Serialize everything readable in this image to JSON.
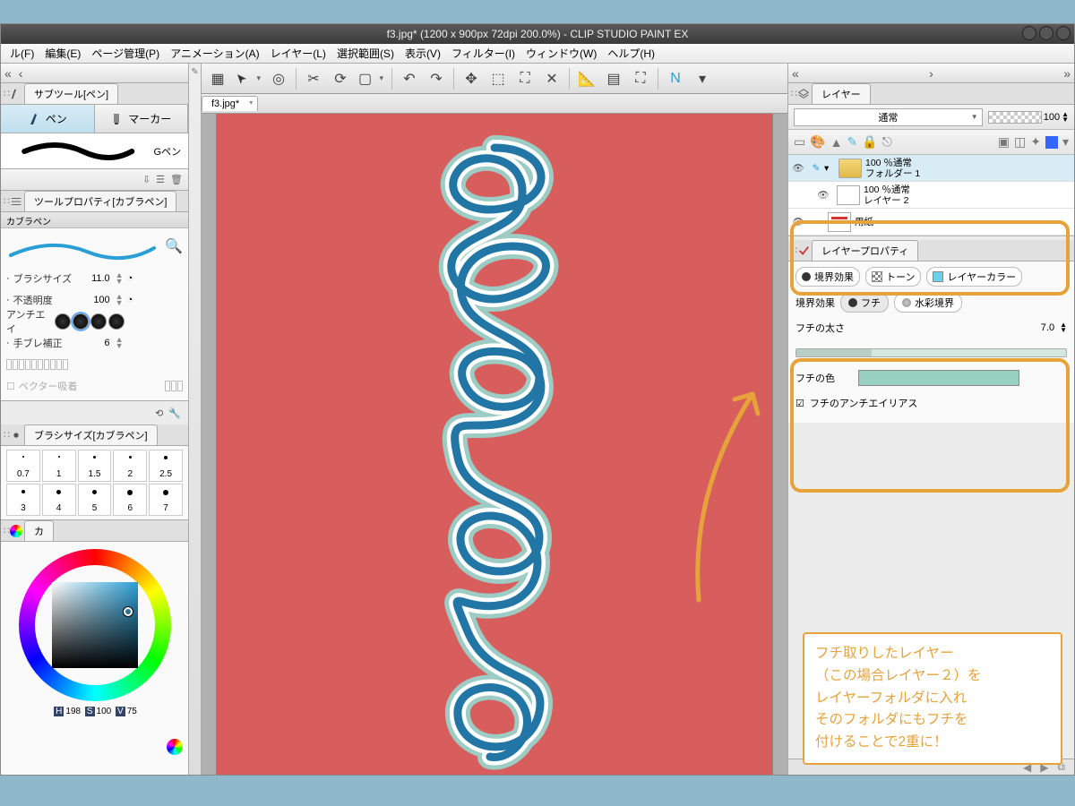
{
  "window": {
    "title": "f3.jpg* (1200 x 900px 72dpi 200.0%)  - CLIP STUDIO PAINT EX"
  },
  "menu": [
    "ル(F)",
    "編集(E)",
    "ページ管理(P)",
    "アニメーション(A)",
    "レイヤー(L)",
    "選択範囲(S)",
    "表示(V)",
    "フィルター(I)",
    "ウィンドウ(W)",
    "ヘルプ(H)"
  ],
  "doc_tab": "f3.jpg*",
  "subtool": {
    "title": "サブツール[ペン]",
    "pen": "ペン",
    "marker": "マーカー",
    "brush": "Gペン"
  },
  "toolprop": {
    "title": "ツールプロパティ[カブラペン]",
    "sub": "カブラペン",
    "brush_size_label": "ブラシサイズ",
    "brush_size": "11.0",
    "opacity_label": "不透明度",
    "opacity": "100",
    "aa_label": "アンチエイ",
    "stab_label": "手ブレ補正",
    "stab": "6",
    "vec_label": "ベクター吸着"
  },
  "brushsize": {
    "title": "ブラシサイズ[カブラペン]",
    "vals": [
      "0.7",
      "1",
      "1.5",
      "2",
      "2.5",
      "3",
      "4",
      "5",
      "6",
      "7"
    ]
  },
  "color": {
    "title": "カ",
    "hsv_h": "198",
    "hsv_s": "100",
    "hsv_v": "75"
  },
  "layers": {
    "title": "レイヤー",
    "blend": "通常",
    "opacity": "100",
    "rows": [
      {
        "line1": "100 ％通常",
        "line2": "フォルダー 1",
        "folder": true,
        "sel": true
      },
      {
        "line1": "100 ％通常",
        "line2": "レイヤー 2",
        "folder": false,
        "sel": false
      },
      {
        "line1": "",
        "line2": "用紙",
        "paper": true
      }
    ]
  },
  "layerprop": {
    "title": "レイヤープロパティ",
    "tab_border": "境界効果",
    "tab_tone": "トーン",
    "tab_color": "レイヤーカラー",
    "row_label": "境界効果",
    "seg_fuchi": "フチ",
    "seg_wc": "水彩境界",
    "thick_label": "フチの太さ",
    "thick": "7.0",
    "color_label": "フチの色",
    "aa_label": "フチのアンチエイリアス"
  },
  "annotation": "フチ取りしたレイヤー\n（この場合レイヤー２）を\nレイヤーフォルダに入れ\nそのフォルダにもフチを\n付けることで2重に！"
}
